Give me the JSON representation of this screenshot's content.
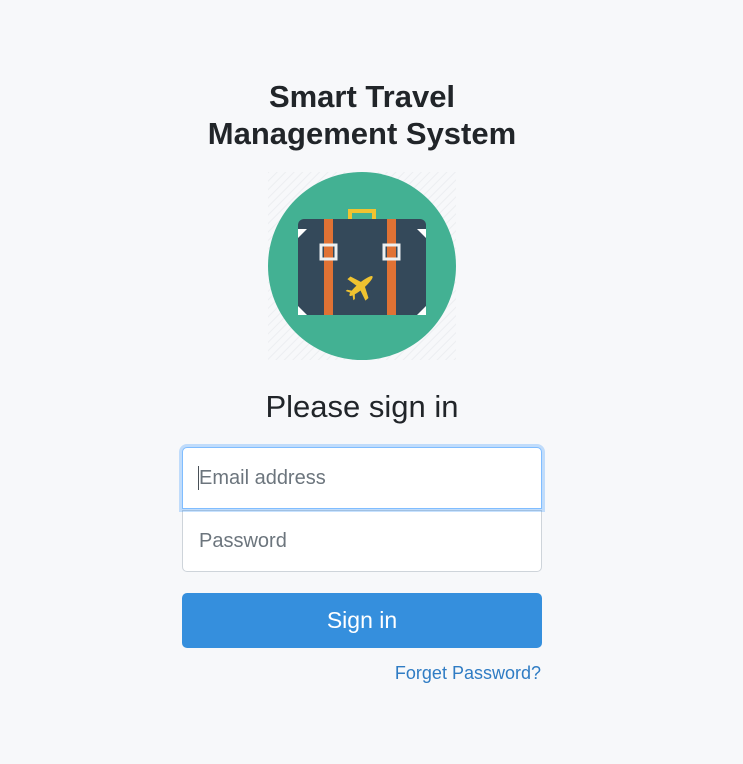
{
  "header": {
    "title_line1": "Smart Travel",
    "title_line2": "Management System"
  },
  "logo": {
    "icon": "suitcase-airplane-icon",
    "colors": {
      "circle": "#43b193",
      "case": "#34495a",
      "straps": "#e07234",
      "handle": "#f0c330",
      "plane": "#f0c330"
    }
  },
  "form": {
    "heading": "Please sign in",
    "email_placeholder": "Email address",
    "password_placeholder": "Password",
    "submit_label": "Sign in",
    "forgot_label": "Forget Password?"
  },
  "theme": {
    "accent": "#358fdd",
    "link": "#2f7cc4",
    "background": "#f7f8fa"
  }
}
